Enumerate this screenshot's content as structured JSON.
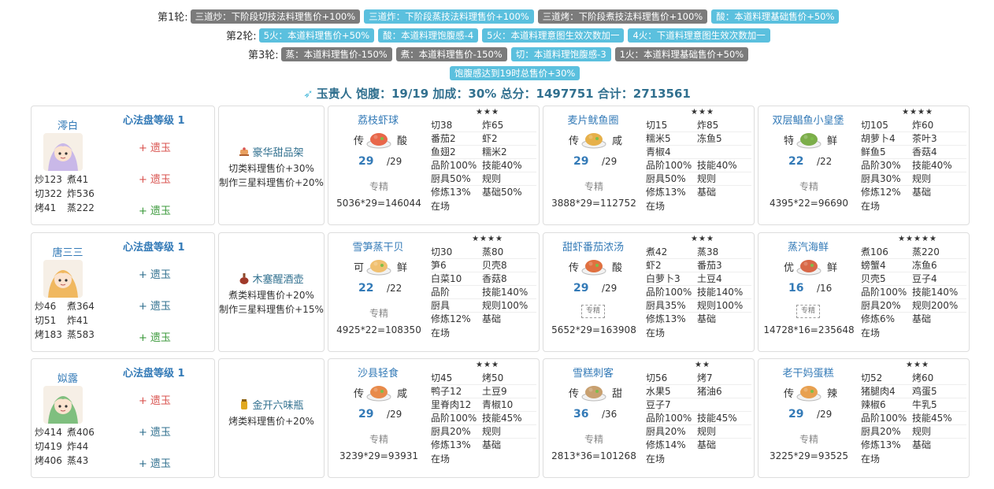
{
  "rounds": [
    {
      "label": "第1轮:",
      "tags": [
        {
          "text": "三道炒：下阶段切技法料理售价+100%",
          "color": "gray"
        },
        {
          "text": "三道炸：下阶段蒸技法料理售价+100%",
          "color": "blue"
        },
        {
          "text": "三道烤：下阶段煮技法料理售价+100%",
          "color": "gray"
        },
        {
          "text": "酸：本道料理基础售价+50%",
          "color": "blue"
        }
      ]
    },
    {
      "label": "第2轮:",
      "tags": [
        {
          "text": "5火：本道料理售价+50%",
          "color": "blue"
        },
        {
          "text": "酸：本道料理饱腹感-4",
          "color": "blue"
        },
        {
          "text": "5火：本道料理意图生效次数加一",
          "color": "blue"
        },
        {
          "text": "4火：下道料理意图生效次数加一",
          "color": "blue"
        }
      ]
    },
    {
      "label": "第3轮:",
      "tags": [
        {
          "text": "蒸：本道料理售价-150%",
          "color": "gray"
        },
        {
          "text": "煮：本道料理售价-150%",
          "color": "gray"
        },
        {
          "text": "切：本道料理饱腹感-3",
          "color": "blue"
        },
        {
          "text": "1火：本道料理基础售价+50%",
          "color": "gray"
        }
      ]
    },
    {
      "label": "",
      "tags": [
        {
          "text": "饱腹感达到19时总售价+30%",
          "color": "blue"
        }
      ]
    }
  ],
  "summary": {
    "text": "玉贵人 饱腹：19/19 加成：30% 总分：1497751 合计：2713561",
    "icon": "sword-icon"
  },
  "rows": [
    {
      "chef": {
        "name": "澪白",
        "level": "心法盘等级 1",
        "stats": [
          [
            "炒123",
            "煮41"
          ],
          [
            "切322",
            "炸536"
          ],
          [
            "烤41",
            "蒸222"
          ]
        ],
        "gems": [
          {
            "text": "遗玉",
            "color": "red"
          },
          {
            "text": "遗玉",
            "color": "red"
          },
          {
            "text": "遗玉",
            "color": "green"
          }
        ],
        "accent": "#c9b8e8"
      },
      "equip": {
        "name": "豪华甜品架",
        "icon": "cake-stand-icon",
        "effects": [
          "切类料理售价+30%",
          "制作三星料理售价+20%"
        ]
      },
      "recipes": [
        {
          "name": "荔枝虾球",
          "stars": "★★★",
          "rank": "传",
          "skill": "酸",
          "qty": "29",
          "max": "/29",
          "special": "专精",
          "calc": "5036*29=146044",
          "lines": [
            [
              "切38",
              "炸65"
            ],
            [
              "番茄2",
              "虾2"
            ],
            [
              "鱼翅2",
              "糯米2"
            ],
            [
              "品阶100%",
              "技能40%"
            ],
            [
              "厨具50%",
              "规则"
            ],
            [
              "修炼13%",
              "基础50%"
            ]
          ],
          "onfield": "在场",
          "food": "#e8674a"
        },
        {
          "name": "麦片鱿鱼圈",
          "stars": "★★★",
          "rank": "传",
          "skill": "咸",
          "qty": "29",
          "max": "/29",
          "special": "专精",
          "calc": "3888*29=112752",
          "lines": [
            [
              "切15",
              "炸85"
            ],
            [
              "糯米5",
              "冻鱼5"
            ],
            [
              "青椒4",
              ""
            ],
            [
              "品阶100%",
              "技能40%"
            ],
            [
              "厨具50%",
              "规则"
            ],
            [
              "修炼13%",
              "基础"
            ]
          ],
          "onfield": "在场",
          "food": "#e6b04a"
        },
        {
          "name": "双层鲳鱼小皇堡",
          "stars": "★★★★",
          "rank": "特",
          "skill": "鲜",
          "qty": "22",
          "max": "/22",
          "special": "专精",
          "calc": "4395*22=96690",
          "lines": [
            [
              "切105",
              "炸60"
            ],
            [
              "胡萝卜4",
              "茶叶3"
            ],
            [
              "鲜鱼5",
              "香菇4"
            ],
            [
              "品阶30%",
              "技能40%"
            ],
            [
              "厨具30%",
              "规则"
            ],
            [
              "修炼12%",
              "基础"
            ]
          ],
          "onfield": "在场",
          "food": "#7cae4a"
        }
      ]
    },
    {
      "chef": {
        "name": "唐三三",
        "level": "心法盘等级 1",
        "stats": [
          [
            "炒46",
            "煮364"
          ],
          [
            "切51",
            "炸41"
          ],
          [
            "烤183",
            "蒸583"
          ]
        ],
        "gems": [
          {
            "text": "遗玉",
            "color": "blue"
          },
          {
            "text": "遗玉",
            "color": "blue"
          },
          {
            "text": "遗玉",
            "color": "green"
          }
        ],
        "accent": "#f0b860"
      },
      "equip": {
        "name": "木塞醒酒壶",
        "icon": "decanter-icon",
        "effects": [
          "煮类料理售价+20%",
          "制作三星料理售价+15%"
        ]
      },
      "recipes": [
        {
          "name": "雪笋蒸干贝",
          "stars": "★★★★",
          "rank": "可",
          "skill": "鲜",
          "qty": "22",
          "max": "/22",
          "special": "专精",
          "calc": "4925*22=108350",
          "lines": [
            [
              "切30",
              "蒸80"
            ],
            [
              "笋6",
              "贝壳8"
            ],
            [
              "白菜10",
              "香菇8"
            ],
            [
              "品阶",
              "技能140%"
            ],
            [
              "厨具",
              "规则100%"
            ],
            [
              "修炼12%",
              "基础"
            ]
          ],
          "onfield": "在场",
          "food": "#f0c070"
        },
        {
          "name": "甜虾番茄浓汤",
          "stars": "★★★",
          "rank": "传",
          "skill": "酸",
          "qty": "29",
          "max": "/29",
          "special": "专精",
          "calc": "5652*29=163908",
          "lines": [
            [
              "煮42",
              "蒸38"
            ],
            [
              "虾2",
              "番茄3"
            ],
            [
              "白萝卜3",
              "土豆4"
            ],
            [
              "品阶100%",
              "技能140%"
            ],
            [
              "厨具35%",
              "规则100%"
            ],
            [
              "修炼13%",
              "基础"
            ]
          ],
          "onfield": "在场",
          "food": "#e07040"
        },
        {
          "name": "蒸汽海鲜",
          "stars": "★★★★★",
          "rank": "优",
          "skill": "鲜",
          "qty": "16",
          "max": "/16",
          "special": "专精",
          "calc": "14728*16=235648",
          "lines": [
            [
              "煮106",
              "蒸220"
            ],
            [
              "螃蟹4",
              "冻鱼6"
            ],
            [
              "贝壳5",
              "豆子4"
            ],
            [
              "品阶100%",
              "技能140%"
            ],
            [
              "厨具20%",
              "规则200%"
            ],
            [
              "修炼6%",
              "基础"
            ]
          ],
          "onfield": "在场",
          "food": "#d86848"
        }
      ]
    },
    {
      "chef": {
        "name": "姒露",
        "level": "心法盘等级 1",
        "stats": [
          [
            "炒414",
            "煮406"
          ],
          [
            "切419",
            "炸44"
          ],
          [
            "烤406",
            "蒸43"
          ]
        ],
        "gems": [
          {
            "text": "遗玉",
            "color": "red"
          },
          {
            "text": "遗玉",
            "color": "blue"
          },
          {
            "text": "遗玉",
            "color": "blue"
          }
        ],
        "accent": "#7fbf7f"
      },
      "equip": {
        "name": "金开六味瓶",
        "icon": "spice-jar-icon",
        "effects": [
          "烤类料理售价+20%"
        ]
      },
      "recipes": [
        {
          "name": "沙县轻食",
          "stars": "★★★",
          "rank": "传",
          "skill": "咸",
          "qty": "29",
          "max": "/29",
          "special": "专精",
          "calc": "3239*29=93931",
          "lines": [
            [
              "切45",
              "烤50"
            ],
            [
              "鸭子12",
              "土豆9"
            ],
            [
              "里脊肉12",
              "青椒10"
            ],
            [
              "品阶100%",
              "技能45%"
            ],
            [
              "厨具20%",
              "规则"
            ],
            [
              "修炼13%",
              "基础"
            ]
          ],
          "onfield": "在场",
          "food": "#e88a4a"
        },
        {
          "name": "雪糕刺客",
          "stars": "★★",
          "rank": "传",
          "skill": "甜",
          "qty": "36",
          "max": "/36",
          "special": "专精",
          "calc": "2813*36=101268",
          "lines": [
            [
              "切56",
              "烤7"
            ],
            [
              "水果5",
              "猪油6"
            ],
            [
              "豆子7",
              ""
            ],
            [
              "品阶100%",
              "技能45%"
            ],
            [
              "厨具20%",
              "规则"
            ],
            [
              "修炼14%",
              "基础"
            ]
          ],
          "onfield": "在场",
          "food": "#c8a070"
        },
        {
          "name": "老干妈蛋糕",
          "stars": "★★★",
          "rank": "传",
          "skill": "辣",
          "qty": "29",
          "max": "/29",
          "special": "专精",
          "calc": "3225*29=93525",
          "lines": [
            [
              "切52",
              "烤60"
            ],
            [
              "猪腿肉4",
              "鸡蛋5"
            ],
            [
              "辣椒6",
              "牛乳5"
            ],
            [
              "品阶100%",
              "技能45%"
            ],
            [
              "厨具20%",
              "规则"
            ],
            [
              "修炼13%",
              "基础"
            ]
          ],
          "onfield": "在场",
          "food": "#e8a050"
        }
      ]
    }
  ],
  "colors": {
    "tag_gray": "#7b7b7b",
    "tag_blue": "#5bc0de",
    "link": "#337ab7",
    "gem_red": "#d9534f",
    "gem_green": "#3c9a3c"
  }
}
